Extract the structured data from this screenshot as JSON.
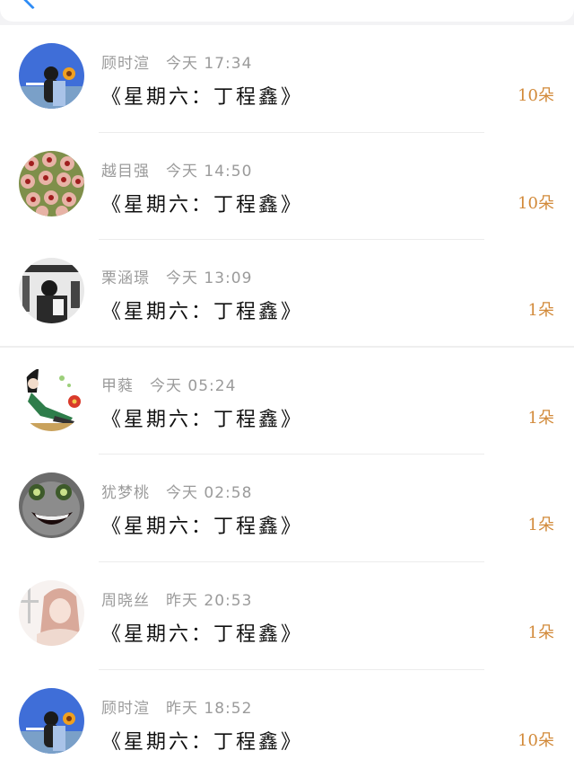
{
  "messages": [
    {
      "name": "顾时渲",
      "time": "今天 17:34",
      "title": "《星期六：丁程鑫》",
      "count": "10朵",
      "avatar": "girl-with-sunflower-avatar"
    },
    {
      "name": "越目强",
      "time": "今天 14:50",
      "title": "《星期六：丁程鑫》",
      "count": "10朵",
      "avatar": "flower-cluster-avatar"
    },
    {
      "name": "栗涵璟",
      "time": "今天 13:09",
      "title": "《星期六：丁程鑫》",
      "count": "1朵",
      "avatar": "bw-person-avatar"
    },
    {
      "name": "甲蕤",
      "time": "今天 05:24",
      "title": "《星期六：丁程鑫》",
      "count": "1朵",
      "avatar": "anime-girl-flowers-avatar"
    },
    {
      "name": "犹梦桃",
      "time": "今天 02:58",
      "title": "《星期六：丁程鑫》",
      "count": "1朵",
      "avatar": "creepy-face-avatar"
    },
    {
      "name": "周晓丝",
      "time": "昨天 20:53",
      "title": "《星期六：丁程鑫》",
      "count": "1朵",
      "avatar": "pink-hair-girl-avatar"
    },
    {
      "name": "顾时渲",
      "time": "昨天 18:52",
      "title": "《星期六：丁程鑫》",
      "count": "10朵",
      "avatar": "girl-with-sunflower-avatar"
    }
  ],
  "colors": {
    "name_text": "#9b9b9b",
    "title_text": "#111111",
    "count_text": "#d28a3a",
    "back_icon": "#2f8cf5"
  }
}
